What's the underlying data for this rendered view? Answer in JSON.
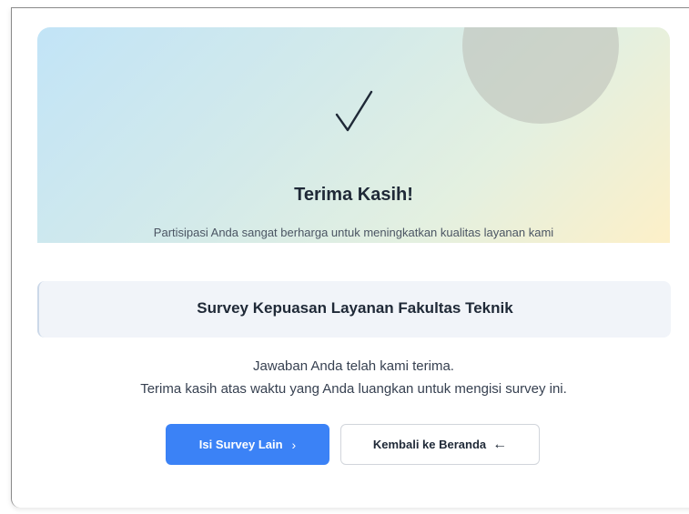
{
  "hero": {
    "title": "Terima Kasih!",
    "subtitle": "Partisipasi Anda sangat berharga untuk meningkatkan kualitas layanan kami",
    "icon": "checkmark-icon"
  },
  "survey": {
    "title": "Survey Kepuasan Layanan Fakultas Teknik"
  },
  "messages": {
    "line1": "Jawaban Anda telah kami terima.",
    "line2": "Terima kasih atas waktu yang Anda luangkan untuk mengisi survey ini."
  },
  "buttons": {
    "fill_other": {
      "label": "Isi Survey Lain",
      "icon": "chevron-right-icon"
    },
    "back_home": {
      "label": "Kembali ke Beranda",
      "icon": "arrow-left-icon"
    }
  },
  "colors": {
    "primary": "#3b82f6",
    "text_dark": "#1f2937",
    "survey_box_bg": "#f1f4f9"
  }
}
